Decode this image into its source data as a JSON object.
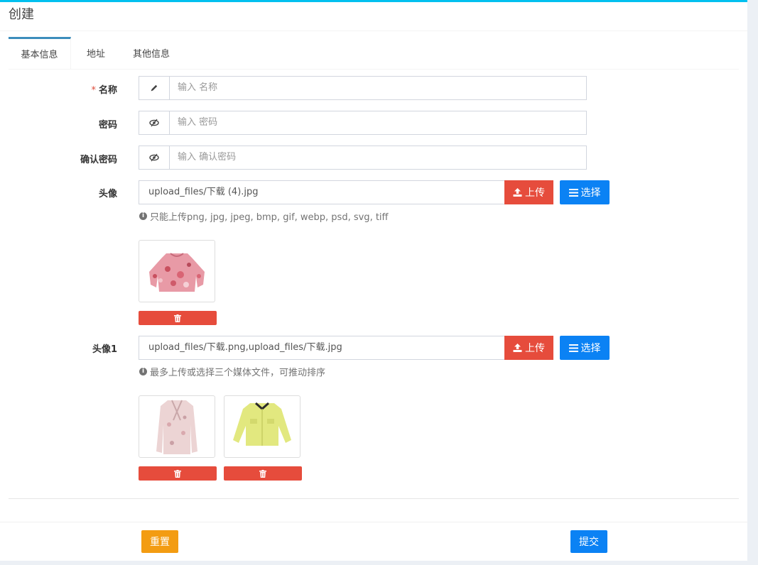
{
  "header": {
    "title": "创建"
  },
  "tabs": [
    {
      "label": "基本信息",
      "active": true
    },
    {
      "label": "地址",
      "active": false
    },
    {
      "label": "其他信息",
      "active": false
    }
  ],
  "form": {
    "name": {
      "label": "名称",
      "required_mark": "*",
      "placeholder": "输入 名称",
      "icon": "pencil-icon"
    },
    "password": {
      "label": "密码",
      "placeholder": "输入 密码",
      "icon": "eye-slash-icon"
    },
    "password_confirm": {
      "label": "确认密码",
      "placeholder": "输入 确认密码",
      "icon": "eye-slash-icon"
    },
    "avatar": {
      "label": "头像",
      "value": "upload_files/下载 (4).jpg",
      "upload_label": "上传",
      "select_label": "选择",
      "help": "只能上传png, jpg, jpeg, bmp, gif, webp, psd, svg, tiff",
      "images": [
        {
          "description": "pink floral blouse"
        }
      ]
    },
    "avatar1": {
      "label": "头像1",
      "value": "upload_files/下载.png,upload_files/下载.jpg",
      "upload_label": "上传",
      "select_label": "选择",
      "help": "最多上传或选择三个媒体文件，可推动排序",
      "images": [
        {
          "description": "pink floral shirt"
        },
        {
          "description": "yellow jacket"
        }
      ]
    }
  },
  "footer": {
    "reset_label": "重置",
    "submit_label": "提交"
  },
  "colors": {
    "accent": "#00c0ef",
    "upload": "#e64c3c",
    "select": "#0b82f4",
    "reset": "#f39c12"
  }
}
